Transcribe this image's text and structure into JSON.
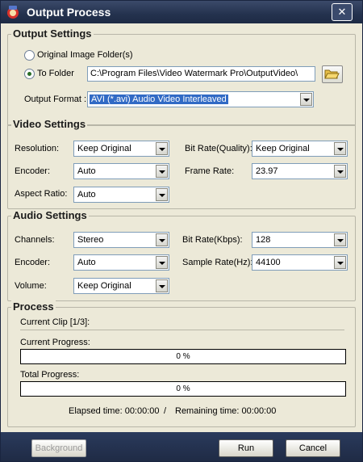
{
  "window": {
    "title": "Output Process",
    "close": "✕"
  },
  "output": {
    "title": "Output Settings",
    "original_folder_label": "Original Image Folder(s)",
    "to_folder_label": "To Folder",
    "folder_path": "C:\\Program Files\\Video Watermark Pro\\OutputVideo\\",
    "format_label": "Output Format :",
    "format_value": "AVI   (*.avi) Audio Video Interleaved"
  },
  "video": {
    "title": "Video Settings",
    "resolution_label": "Resolution:",
    "resolution_value": "Keep Original",
    "encoder_label": "Encoder:",
    "encoder_value": "Auto",
    "aspect_label": "Aspect Ratio:",
    "aspect_value": "Auto",
    "bitrate_label": "Bit Rate(Quality):",
    "bitrate_value": "Keep Original",
    "framerate_label": "Frame Rate:",
    "framerate_value": "23.97"
  },
  "audio": {
    "title": "Audio Settings",
    "channels_label": "Channels:",
    "channels_value": "Stereo",
    "encoder_label": "Encoder:",
    "encoder_value": "Auto",
    "volume_label": "Volume:",
    "volume_value": "Keep Original",
    "bitrate_label": "Bit Rate(Kbps):",
    "bitrate_value": "128",
    "samplerate_label": "Sample Rate(Hz):",
    "samplerate_value": "44100"
  },
  "process": {
    "title": "Process",
    "current_clip": "Current Clip [1/3]:",
    "current_progress_label": "Current Progress:",
    "current_progress_text": "0 %",
    "current_progress_value": 0,
    "total_progress_label": "Total Progress:",
    "total_progress_text": "0 %",
    "total_progress_value": 0,
    "elapsed": "Elapsed time: 00:00:00",
    "divider": "/",
    "remaining": "Remaining time: 00:00:00"
  },
  "buttons": {
    "background": "Background",
    "run": "Run",
    "cancel": "Cancel"
  }
}
